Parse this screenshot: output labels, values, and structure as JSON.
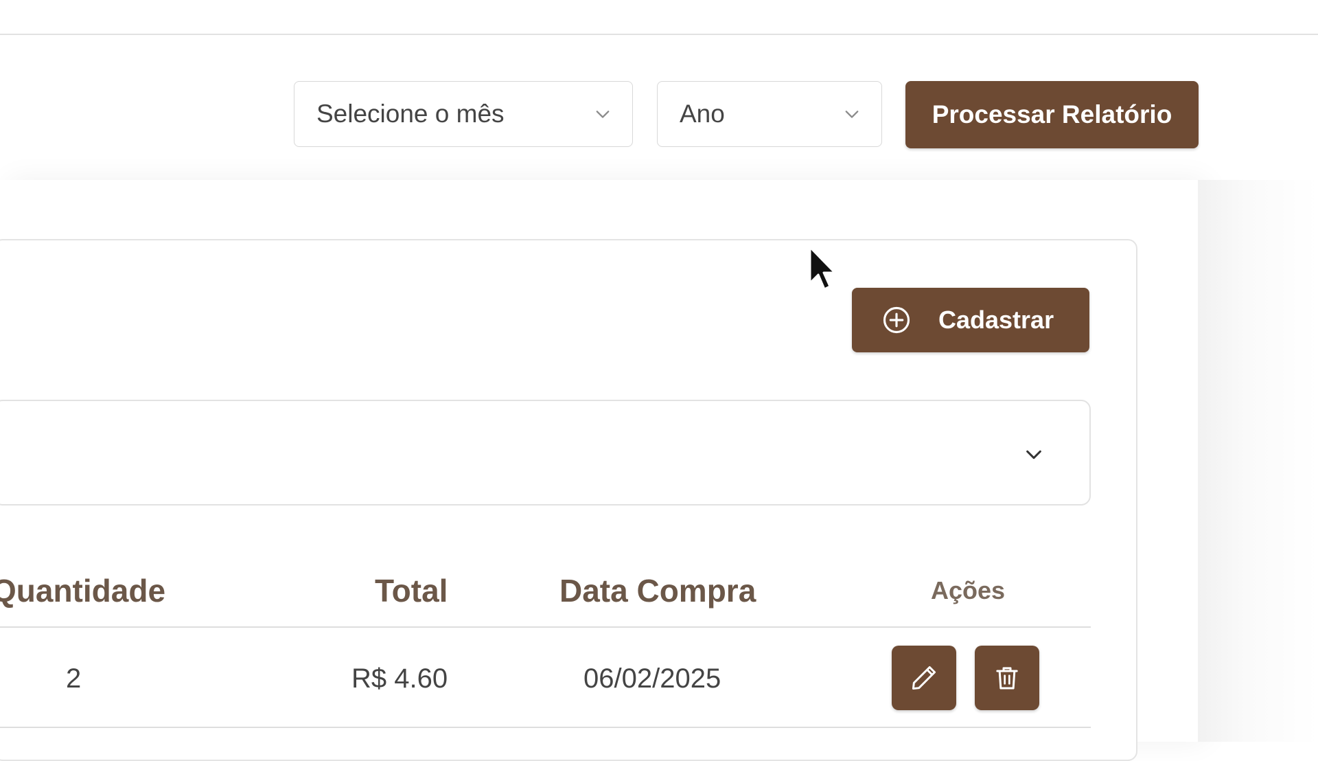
{
  "filters": {
    "month_select": "Selecione o mês",
    "year_select": "Ano",
    "process_button": "Processar Relatório"
  },
  "panel": {
    "register_button": "Cadastrar"
  },
  "table": {
    "headers": [
      "Quantidade",
      "Total",
      "Data Compra",
      "Ações"
    ],
    "rows": [
      {
        "quantidade": "2",
        "total": "R$ 4.60",
        "data_compra": "06/02/2025"
      }
    ]
  },
  "icons": [
    "chevron-down-icon",
    "plus-circle-icon",
    "pencil-icon",
    "trash-icon",
    "cursor-icon"
  ],
  "colors": {
    "accent": "#6d4a33",
    "header_text": "#6b5748",
    "border": "#e2e2e2"
  }
}
